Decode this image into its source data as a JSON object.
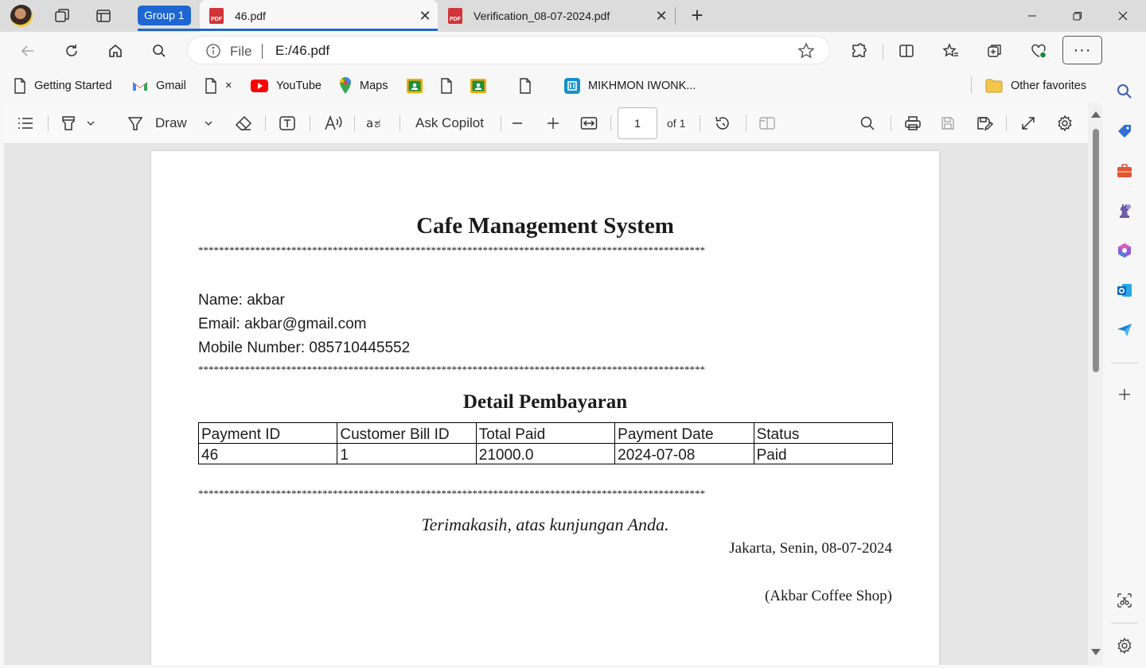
{
  "tabstrip": {
    "group_label": "Group 1",
    "tabs": [
      {
        "title": "46.pdf",
        "icon": "pdf-icon",
        "active": true
      },
      {
        "title": "Verification_08-07-2024.pdf",
        "icon": "pdf-icon",
        "active": false
      }
    ],
    "pdf_badge": "PDF"
  },
  "toolbar": {
    "address": {
      "scheme_label": "File",
      "url": "E:/46.pdf"
    },
    "more_label": "···"
  },
  "bookmarks": [
    {
      "label": "Getting Started",
      "icon": "page-icon"
    },
    {
      "label": "Gmail",
      "icon": "gmail-icon"
    },
    {
      "label": "×",
      "icon": "page-icon"
    },
    {
      "label": "YouTube",
      "icon": "youtube-icon"
    },
    {
      "label": "Maps",
      "icon": "maps-icon"
    },
    {
      "label": "",
      "icon": "classroom-icon"
    },
    {
      "label": "",
      "icon": "page-icon"
    },
    {
      "label": "",
      "icon": "classroom-icon"
    },
    {
      "label": "",
      "icon": "page-icon"
    },
    {
      "label": "MIKHMON IWONK...",
      "icon": "mikhmon-icon"
    }
  ],
  "other_favorites": "Other favorites",
  "pdf_toolbar": {
    "draw_label": "Draw",
    "ask_copilot_label": "Ask Copilot",
    "page_number": "1",
    "page_of": "of 1"
  },
  "document": {
    "title": "Cafe Management System",
    "separator": "**************************************************************************************************",
    "name_line": "Name: akbar",
    "email_line": "Email: akbar@gmail.com",
    "mobile_line": "Mobile Number: 085710445552",
    "section_title": "Detail Pembayaran",
    "table": {
      "headers": [
        "Payment ID",
        "Customer Bill ID",
        "Total Paid",
        "Payment Date",
        "Status"
      ],
      "rows": [
        [
          "46",
          "1",
          "21000.0",
          "2024-07-08",
          "Paid"
        ]
      ]
    },
    "thanks": "Terimakasih, atas kunjungan Anda.",
    "place_date": "Jakarta, Senin, 08-07-2024",
    "shop": "(Akbar Coffee Shop)"
  },
  "colors": {
    "accent": "#1e66d0",
    "pdf_red": "#d13438",
    "tabstrip_bg": "#dcdcdc",
    "viewer_bg": "#e6e6e6"
  }
}
